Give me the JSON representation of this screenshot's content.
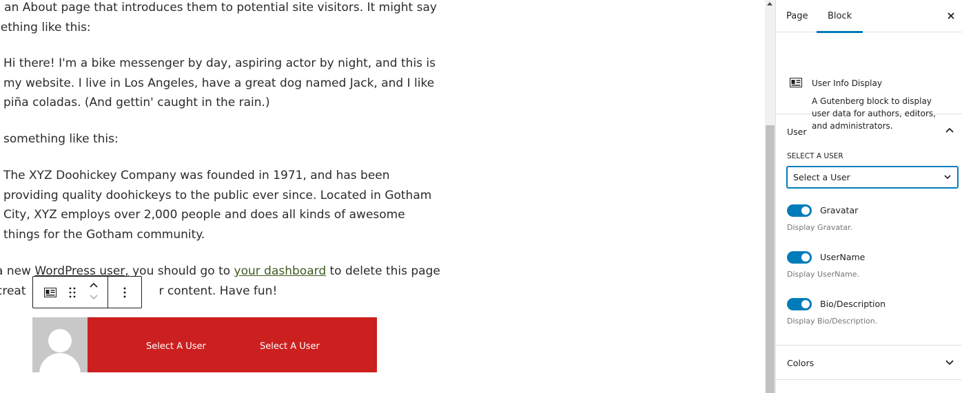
{
  "editor": {
    "intro_line1": "n an About page that introduces them to potential site visitors. It might say",
    "intro_line2": "nething like this:",
    "quote1": [
      "Hi there! I'm a bike messenger by day, aspiring actor by night, and this is",
      "my website. I live in Los Angeles, have a great dog named Jack, and I like",
      "piña coladas. (And gettin' caught in the rain.)"
    ],
    "para2": "something like this:",
    "quote2": [
      "The XYZ Doohickey Company was founded in 1971, and has been",
      "providing quality doohickeys to the public ever since. Located in Gotham",
      "City, XYZ employs over 2,000 people and does all kinds of awesome",
      "things for the Gotham community."
    ],
    "para3": {
      "before_link1": "a new ",
      "link1": "WordPress user,",
      "between": " you should go to ",
      "link2": "your dashboard",
      "after": " to delete this page",
      "line2_start": " creat",
      "line2_end": "r content. Have fun!"
    }
  },
  "block_preview": {
    "username_text": "Select A User",
    "bio_text": "Select A User",
    "accent_color": "#cc1f1f",
    "avatar_bg": "#c8c8c8"
  },
  "toolbar": {
    "icons": [
      "id-card-icon",
      "drag-handle-icon",
      "move-up-icon",
      "move-down-icon",
      "more-options-icon"
    ]
  },
  "sidebar": {
    "tabs": [
      {
        "label": "Page"
      },
      {
        "label": "Block",
        "active": true
      }
    ],
    "block_card": {
      "title": "User Info Display",
      "description": "A Gutenberg block to display user data for authors, editors, and administrators."
    },
    "user_panel": {
      "title": "User",
      "select_label": "SELECT A USER",
      "select_value": "Select a User",
      "toggles": [
        {
          "label": "Gravatar",
          "help": "Display Gravatar.",
          "checked": true
        },
        {
          "label": "UserName",
          "help": "Display UserName.",
          "checked": true
        },
        {
          "label": "Bio/Description",
          "help": "Display Bio/Description.",
          "checked": true
        }
      ]
    },
    "colors_panel": {
      "title": "Colors"
    }
  },
  "colors": {
    "accent": "#007cba",
    "text": "#1e1e1e"
  }
}
